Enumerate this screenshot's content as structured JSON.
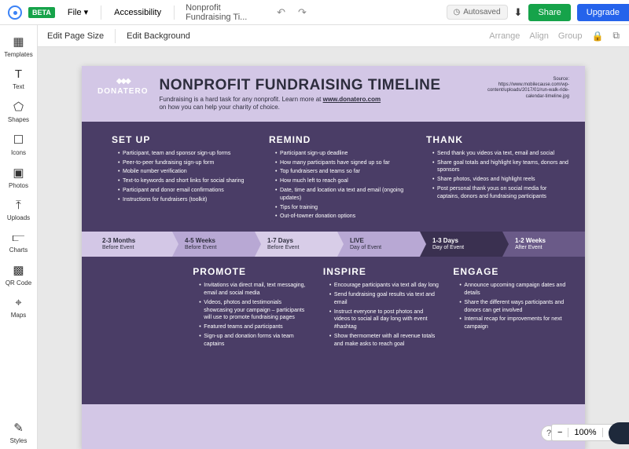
{
  "topbar": {
    "beta": "BETA",
    "file": "File",
    "chevron": "▾",
    "accessibility": "Accessibility",
    "docTitle": "Nonprofit Fundraising Ti...",
    "autosaved": "Autosaved",
    "share": "Share",
    "upgrade": "Upgrade"
  },
  "sidebar": {
    "templates": "Templates",
    "text": "Text",
    "shapes": "Shapes",
    "icons": "Icons",
    "photos": "Photos",
    "uploads": "Uploads",
    "charts": "Charts",
    "qrcode": "QR Code",
    "maps": "Maps",
    "styles": "Styles"
  },
  "toolbar2": {
    "editPage": "Edit Page Size",
    "editBg": "Edit Background",
    "arrange": "Arrange",
    "align": "Align",
    "group": "Group"
  },
  "doc": {
    "brand": "DONATERO",
    "title": "NONPROFIT FUNDRAISING TIMELINE",
    "subtitle1": "Fundraising is a hard task for any nonprofit. Learn more at ",
    "link": "www.donatero.com",
    "subtitle2": "on how you can help your charity of choice.",
    "sourceLabel": "Source:",
    "sourceUrl": "https://www.mobilecause.com/wp-content/uploads/2017/01/run-walk-ride-calendar-timeline.jpg"
  },
  "cols": {
    "setup": {
      "title": "SET UP",
      "items": [
        "Participant, team and sponsor sign-up forms",
        "Peer-to-peer fundraising sign-up form",
        "Mobile number verification",
        "Text-to keywords and short links for social sharing",
        "Participant and donor email confirmations",
        "Instructions for fundraisers (toolkit)"
      ]
    },
    "remind": {
      "title": "REMIND",
      "items": [
        "Participant sign-up deadline",
        "How many participants have signed up so far",
        "Top fundraisers and teams so far",
        "How much left to reach goal",
        "Date, time and location via text and email (ongoing updates)",
        "Tips for training",
        "Out-of-towner donation options"
      ]
    },
    "thank": {
      "title": "THANK",
      "items": [
        "Send thank you videos via text, email and social",
        "Share goal totals and highlight key teams, donors and sponsors",
        "Share photos, videos and highlight reels",
        "Post personal thank yous on social media for captains, donors and fundraising participants"
      ]
    },
    "promote": {
      "title": "PROMOTE",
      "items": [
        "Invitations via direct mail, text messaging, email and social media",
        "Videos, photos and testimonials showcasing your campaign – participants will use to promote fundraising pages",
        "Featured teams and participants",
        "Sign-up and donation forms via team captains"
      ]
    },
    "inspire": {
      "title": "INSPIRE",
      "items": [
        "Encourage participants via text all day long",
        "Send fundraising goal results via text and email",
        "Instruct everyone to post photos and videos to social all day long with event #hashtag",
        "Show thermometer with all revenue totals and make asks to reach goal"
      ]
    },
    "engage": {
      "title": "ENGAGE",
      "items": [
        "Announce upcoming campaign dates and details",
        "Share the different ways participants and donors can get involved",
        "Internal recap for improvements for next campaign"
      ]
    }
  },
  "timeline": [
    {
      "t1": "2-3 Months",
      "t2": "Before Event"
    },
    {
      "t1": "4-5 Weeks",
      "t2": "Before Event"
    },
    {
      "t1": "1-7 Days",
      "t2": "Before Event"
    },
    {
      "t1": "LIVE",
      "t2": "Day of Event"
    },
    {
      "t1": "1-3 Days",
      "t2": "Day of Event"
    },
    {
      "t1": "1-2 Weeks",
      "t2": "After Event"
    }
  ],
  "zoom": {
    "minus": "−",
    "pct": "100%",
    "plus": "+"
  }
}
